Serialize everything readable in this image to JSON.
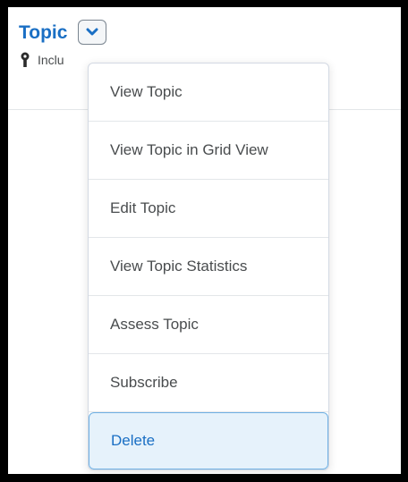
{
  "header": {
    "title": "Topic",
    "subline_text": "Inclu"
  },
  "icons": {
    "dropdown": "chevron-down-icon",
    "restriction": "keyhole-icon"
  },
  "menu": {
    "items": [
      {
        "label": "View Topic"
      },
      {
        "label": "View Topic in Grid View"
      },
      {
        "label": "Edit Topic"
      },
      {
        "label": "View Topic Statistics"
      },
      {
        "label": "Assess Topic"
      },
      {
        "label": "Subscribe"
      },
      {
        "label": "Delete",
        "state": "highlighted"
      }
    ]
  },
  "colors": {
    "title": "#1a6fc4",
    "highlight_background": "#e6f2fb",
    "highlight_border": "#6fb0e3",
    "text": "#494c4e"
  }
}
